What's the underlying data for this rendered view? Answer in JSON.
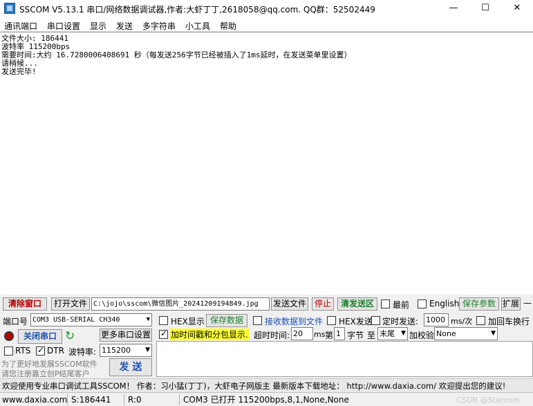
{
  "window": {
    "title": "SSCOM V5.13.1 串口/网络数据调试器,作者:大虾丁丁,2618058@qq.com. QQ群：52502449",
    "minimize": "—",
    "maximize": "☐",
    "close": "✕"
  },
  "menu": [
    "通讯端口",
    "串口设置",
    "显示",
    "发送",
    "多字符串",
    "小工具",
    "帮助"
  ],
  "output_lines": [
    "文件大小: 186441",
    "波特率 115200bps",
    "需要时间:大约 16.7280006408691 秒（每发送256字节已经被插入了1ms延时，在发送菜单里设置）",
    "请稍候...",
    "发送完毕!"
  ],
  "toolbar": {
    "clear_window": "清除窗口",
    "open_file": "打开文件",
    "file_path": "C:\\jojo\\sscom\\微信图片_20241209194849.jpg",
    "send_file": "发送文件",
    "stop": "停止",
    "clear_send_area": "清发送区",
    "topmost": "最前",
    "english": "English",
    "save_params": "保存参数",
    "expand": "扩展",
    "collapse": "—"
  },
  "port": {
    "label": "端口号",
    "value": "COM3 USB-SERIAL CH340",
    "close_port": "关闭串口",
    "more_settings": "更多串口设置",
    "rts": "RTS",
    "dtr": "DTR",
    "baud_label": "波特率:",
    "baud_value": "115200"
  },
  "options": {
    "hex_display": "HEX显示",
    "save_data": "保存数据",
    "receive_to_file": "接收数据到文件",
    "hex_send": "HEX发送",
    "timed_send": "定时发送:",
    "interval": "1000",
    "interval_unit": "ms/次",
    "add_crlf": "加回车换行",
    "timestamp_packet": "加时间戳和分包显示.",
    "timeout_label": "超时时间:",
    "timeout_value": "20",
    "timeout_unit": "ms",
    "byte_prefix": "第",
    "byte_index": "1",
    "byte_label": "字节",
    "to_label": "至",
    "to_value": "末尾",
    "checksum_label": "加校验",
    "checksum_value": "None"
  },
  "promo": {
    "line1": "为了更好地发展SSCOM软件",
    "line2": "请您注册嘉立创P结尾客户"
  },
  "send_button": "发  送",
  "banner": "欢迎使用专业串口调试工具SSCOM！  作者：习小猛(丁丁)，大虾电子网版主  最新版本下载地址： http://www.daxia.com/  欢迎提出您的建议!",
  "status": {
    "site": "www.daxia.com",
    "sent": "S:186441",
    "received": "R:0",
    "port_state": "COM3 已打开  115200bps,8,1,None,None",
    "watermark": "CSDN @Stanmin"
  }
}
